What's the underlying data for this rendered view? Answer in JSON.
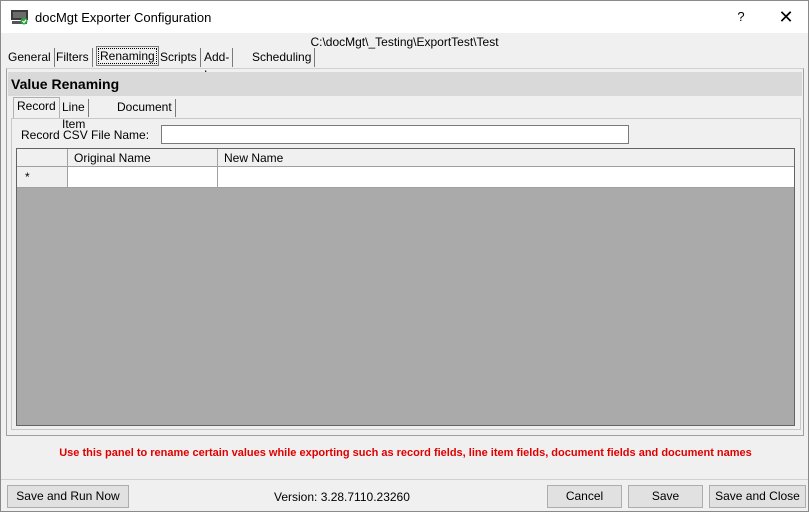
{
  "window": {
    "title": "docMgt Exporter Configuration",
    "help_label": "?",
    "close_label": "✕",
    "path": "C:\\docMgt\\_Testing\\ExportTest\\Test"
  },
  "tabs": [
    {
      "label": "General",
      "active": false
    },
    {
      "label": "Filters",
      "active": false
    },
    {
      "label": "Renaming",
      "active": true
    },
    {
      "label": "Scripts",
      "active": false
    },
    {
      "label": "Add-Ins",
      "active": false
    },
    {
      "label": "Scheduling",
      "active": false
    }
  ],
  "section": {
    "title": "Value Renaming"
  },
  "subtabs": [
    {
      "label": "Record",
      "active": true
    },
    {
      "label": "Line Item",
      "active": false
    },
    {
      "label": "Document",
      "active": false
    }
  ],
  "csv": {
    "label": "Record CSV File Name:",
    "value": ""
  },
  "grid": {
    "columns": [
      "Original Name",
      "New Name"
    ],
    "new_row_marker": "*"
  },
  "info_text": "Use this panel to rename certain values while exporting such as record fields, line item fields, document fields and document names",
  "footer": {
    "save_run_label": "Save and Run Now",
    "version": "Version: 3.28.7110.23260",
    "cancel_label": "Cancel",
    "save_label": "Save",
    "save_close_label": "Save and Close"
  },
  "colors": {
    "info_text": "#e00000",
    "grid_background": "#aaaaaa"
  },
  "icons": {
    "app": "computer-export-icon"
  }
}
